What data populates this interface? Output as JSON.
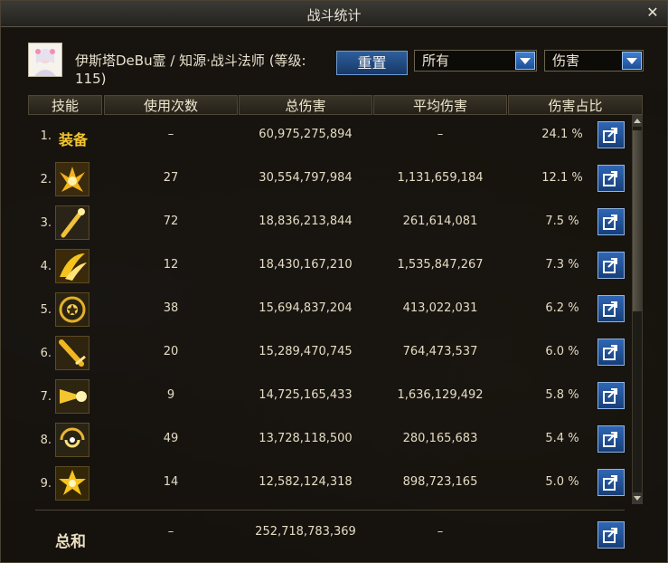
{
  "window": {
    "title": "战斗统计",
    "close_glyph": "✕"
  },
  "character": {
    "name_line": "伊斯塔DeBu霊 / 知源·战斗法师 (等级: 115)"
  },
  "controls": {
    "reset_label": "重置",
    "filter_select": "所有",
    "metric_select": "伤害"
  },
  "table": {
    "headers": [
      "技能",
      "使用次数",
      "总伤害",
      "平均伤害",
      "伤害占比"
    ],
    "rows": [
      {
        "rank": "1.",
        "skill": "装备",
        "icon": "equipment-text",
        "uses": "–",
        "total": "60,975,275,894",
        "avg": "–",
        "pct": "24.1 %"
      },
      {
        "rank": "2.",
        "skill": "",
        "icon": "flame-burst-skill-icon",
        "uses": "27",
        "total": "30,554,797,984",
        "avg": "1,131,659,184",
        "pct": "12.1 %"
      },
      {
        "rank": "3.",
        "skill": "",
        "icon": "staff-strike-skill-icon",
        "uses": "72",
        "total": "18,836,213,844",
        "avg": "261,614,081",
        "pct": "7.5 %"
      },
      {
        "rank": "4.",
        "skill": "",
        "icon": "wing-slash-skill-icon",
        "uses": "12",
        "total": "18,430,167,210",
        "avg": "1,535,847,267",
        "pct": "7.3 %"
      },
      {
        "rank": "5.",
        "skill": "",
        "icon": "orb-ring-skill-icon",
        "uses": "38",
        "total": "15,694,837,204",
        "avg": "413,022,031",
        "pct": "6.2 %"
      },
      {
        "rank": "6.",
        "skill": "",
        "icon": "staff-swing-skill-icon",
        "uses": "20",
        "total": "15,289,470,745",
        "avg": "764,473,537",
        "pct": "6.0 %"
      },
      {
        "rank": "7.",
        "skill": "",
        "icon": "light-burst-skill-icon",
        "uses": "9",
        "total": "14,725,165,433",
        "avg": "1,636,129,492",
        "pct": "5.8 %"
      },
      {
        "rank": "8.",
        "skill": "",
        "icon": "vortex-skill-icon",
        "uses": "49",
        "total": "13,728,118,500",
        "avg": "280,165,683",
        "pct": "5.4 %"
      },
      {
        "rank": "9.",
        "skill": "",
        "icon": "star-explosion-skill-icon",
        "uses": "14",
        "total": "12,582,124,318",
        "avg": "898,723,165",
        "pct": "5.0 %"
      }
    ],
    "total": {
      "label": "总和",
      "uses": "–",
      "total": "252,718,783,369",
      "avg": "–"
    }
  },
  "colors": {
    "accent_blue": "#2f66b3",
    "gold": "#f2c52c"
  }
}
